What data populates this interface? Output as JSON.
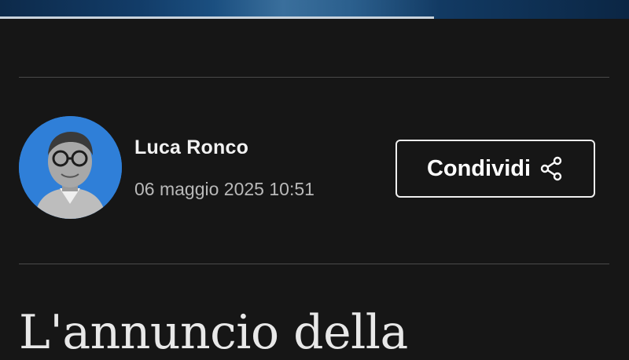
{
  "author": {
    "name": "Luca Ronco",
    "date": "06 maggio 2025 10:51"
  },
  "actions": {
    "share_label": "Condividi",
    "share_icon": "share-icon"
  },
  "article": {
    "headline_visible": "L'annuncio della"
  },
  "colors": {
    "background": "#161616",
    "avatar_bg": "#2f7fd8",
    "text_primary": "#f2f2f2",
    "text_secondary": "#b9b9b9"
  }
}
